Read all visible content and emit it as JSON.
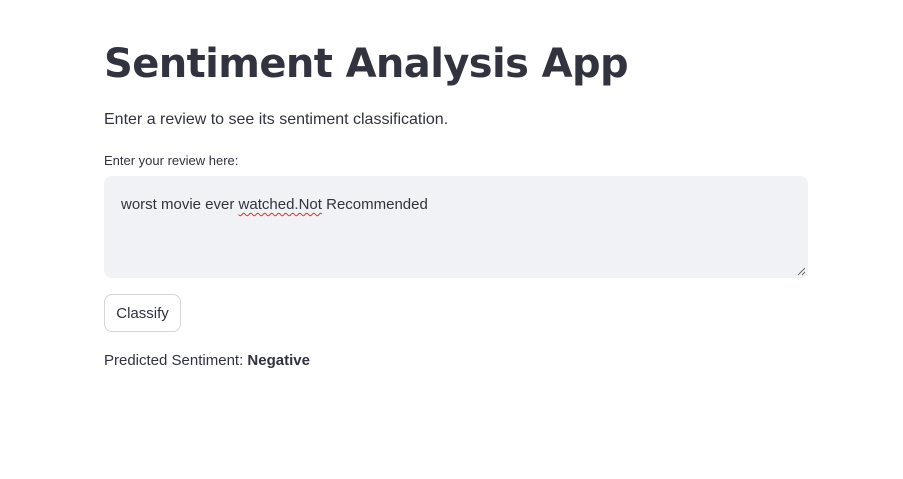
{
  "app": {
    "title": "Sentiment Analysis App",
    "subtitle": "Enter a review to see its sentiment classification."
  },
  "review_input": {
    "label": "Enter your review here:",
    "value_prefix": "worst movie ever ",
    "value_misspelled": "watched.Not",
    "value_suffix": " Recommended"
  },
  "classify_button": {
    "label": "Classify"
  },
  "result": {
    "prefix": "Predicted Sentiment:",
    "value": "Negative"
  },
  "colors": {
    "text": "#31333f",
    "input_bg": "#f0f2f6",
    "button_border": "#d6d6d9",
    "spellcheck_underline": "#e03030"
  }
}
